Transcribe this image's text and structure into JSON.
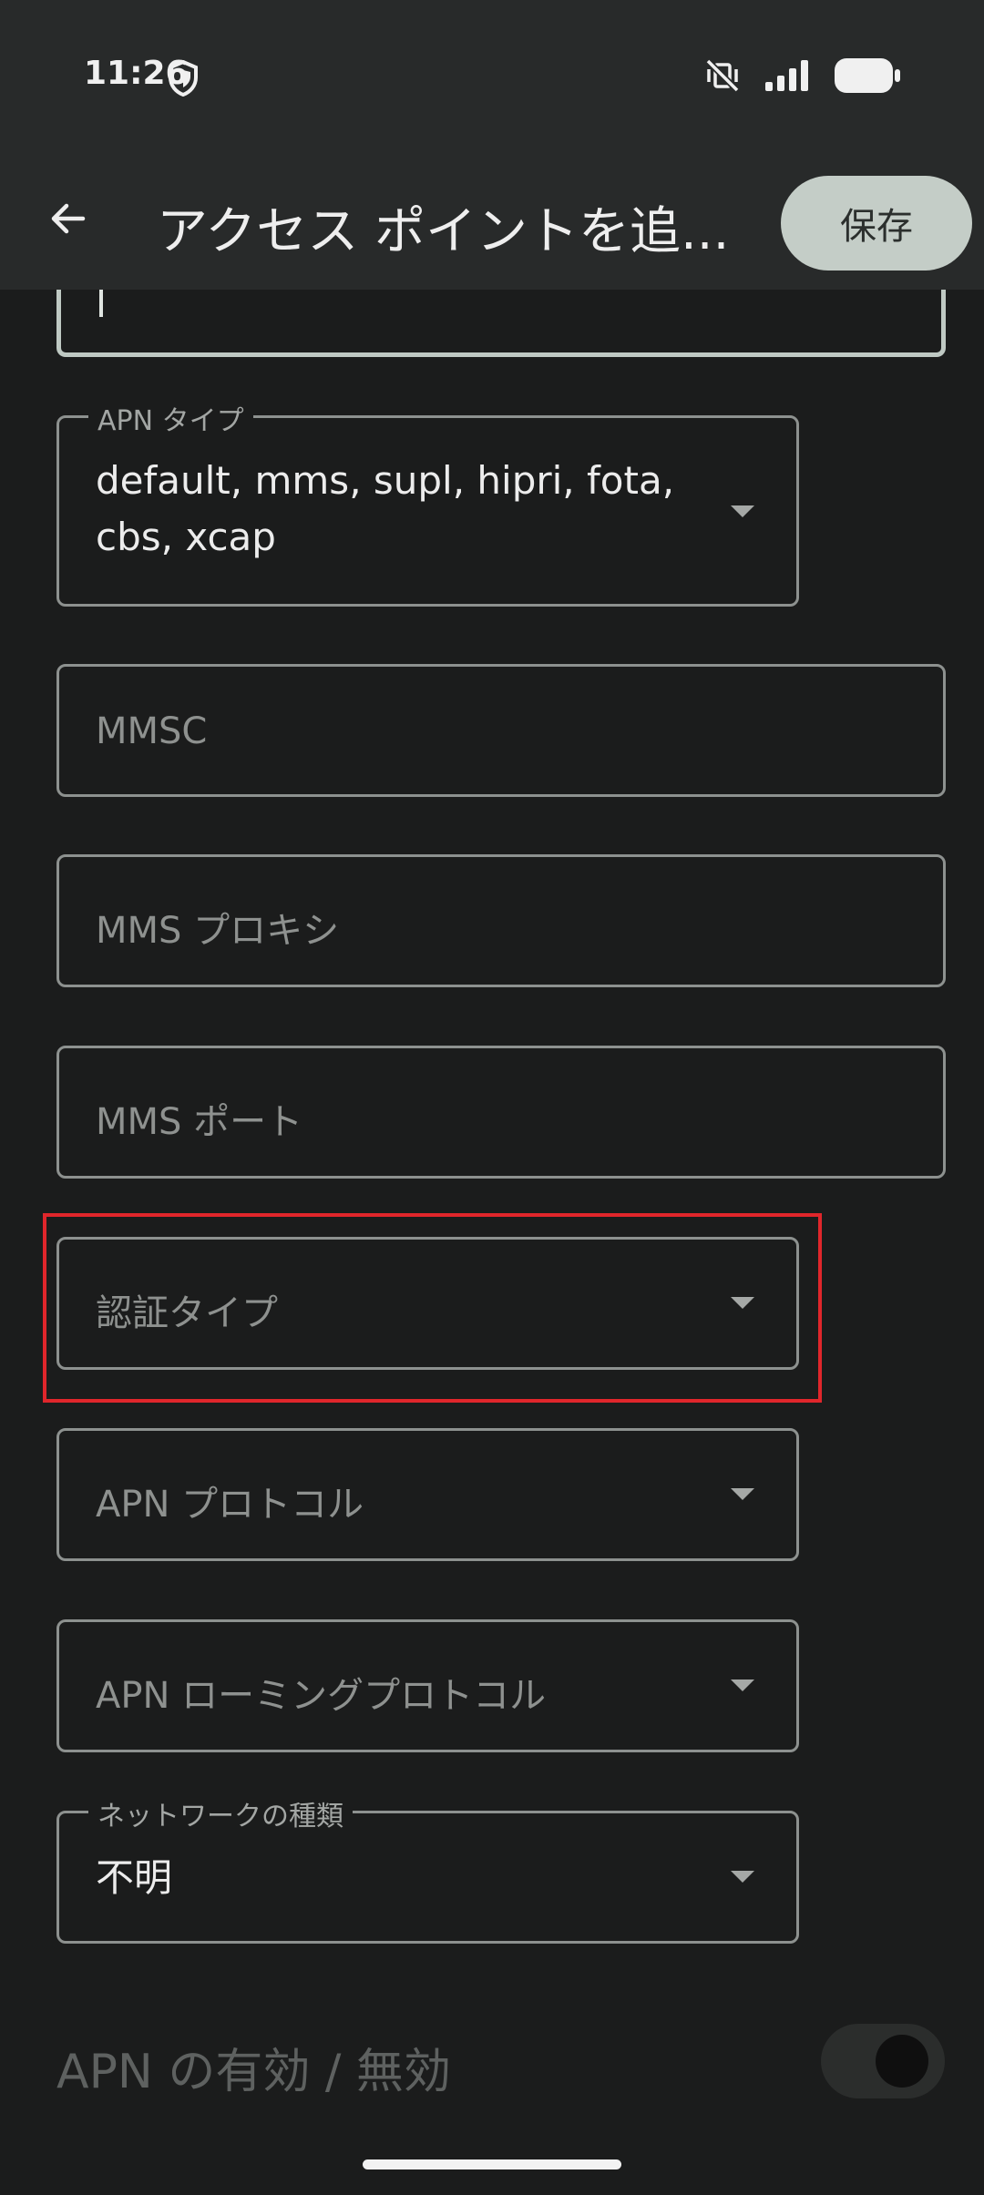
{
  "status_bar": {
    "time": "11:26",
    "icons": [
      "shield-icon",
      "vibrate-off-icon",
      "signal-icon",
      "battery-icon"
    ]
  },
  "app_bar": {
    "title": "アクセス ポイントを追...",
    "save_label": "保存"
  },
  "form": {
    "apn_type": {
      "label": "APN タイプ",
      "value_line1": "default, mms, supl, hipri, fota,",
      "value_line2": "cbs, xcap"
    },
    "mmsc": {
      "placeholder": "MMSC"
    },
    "mms_proxy": {
      "placeholder": "MMS プロキシ"
    },
    "mms_port": {
      "placeholder": "MMS ポート"
    },
    "auth_type": {
      "placeholder": "認証タイプ"
    },
    "apn_protocol": {
      "placeholder": "APN プロトコル"
    },
    "apn_roaming_protocol": {
      "placeholder": "APN ローミングプロトコル"
    },
    "network_type": {
      "label": "ネットワークの種類",
      "value": "不明"
    },
    "apn_enable": {
      "label": "APN の有効 / 無効",
      "enabled": false
    }
  },
  "colors": {
    "background": "#1b1c1c",
    "app_bar": "#282a2a",
    "save_button": "#c4cdc7",
    "highlight": "#e0262b"
  }
}
